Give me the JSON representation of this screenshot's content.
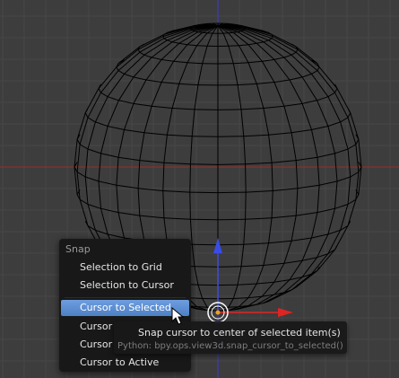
{
  "viewport": {
    "background": "#3d3d3d",
    "grid_color": "#474747",
    "wireframe_color": "#000000",
    "x_axis_color": "#9c2c2c",
    "z_axis_color": "#3b3bd8",
    "manipulator_x_color": "#e02424",
    "manipulator_z_color": "#3a4ce8",
    "origin_color": "#f0a020"
  },
  "snap_menu": {
    "title": "Snap",
    "items": [
      {
        "label": "Selection to Grid",
        "active": false
      },
      {
        "label": "Selection to Cursor",
        "active": false
      },
      {
        "label": "Cursor to Selected",
        "active": true
      },
      {
        "label": "Cursor",
        "active": false
      },
      {
        "label": "Cursor",
        "active": false
      },
      {
        "label": "Cursor to Active",
        "active": false
      }
    ],
    "highlight_color": "#5a8cd2"
  },
  "tooltip": {
    "description": "Snap cursor to center of selected item(s)",
    "python": "Python: bpy.ops.view3d.snap_cursor_to_selected()"
  }
}
